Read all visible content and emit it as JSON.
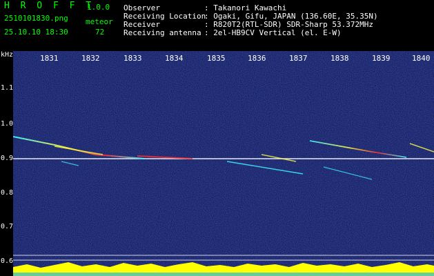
{
  "app": {
    "name": "H R O F F T",
    "version": "1.0.0"
  },
  "file": {
    "name": "2510101830.png",
    "datetime": "25.10.10 18:30"
  },
  "meteor": {
    "label": "meteor",
    "count": "72"
  },
  "info": [
    {
      "key": "Observer",
      "value": ": Takanori Kawachi"
    },
    {
      "key": "Receiving Location",
      "value": ": Ogaki, Gifu, JAPAN (136.60E, 35.35N)"
    },
    {
      "key": "Receiver",
      "value": ": R820T2(RTL-SDR) SDR-Sharp 53.372MHz"
    },
    {
      "key": "Receiving antenna",
      "value": ": 2el-HB9CV Vertical (el. E-W)"
    }
  ],
  "axis": {
    "yunit": "kHz",
    "y_ticks": [
      "1.1",
      "1.0",
      "0.9",
      "0.8",
      "0.7",
      "0.6"
    ],
    "x_ticks": [
      "1831",
      "1832",
      "1833",
      "1834",
      "1835",
      "1836",
      "1837",
      "1838",
      "1839",
      "1840"
    ]
  },
  "colors": {
    "background": "#0a0a3a",
    "carrier": "#ffffff",
    "trace_hot": "#ff3030",
    "trace_warm": "#ffff40",
    "trace_cool": "#40ffff",
    "activity": "#ffff00"
  }
}
